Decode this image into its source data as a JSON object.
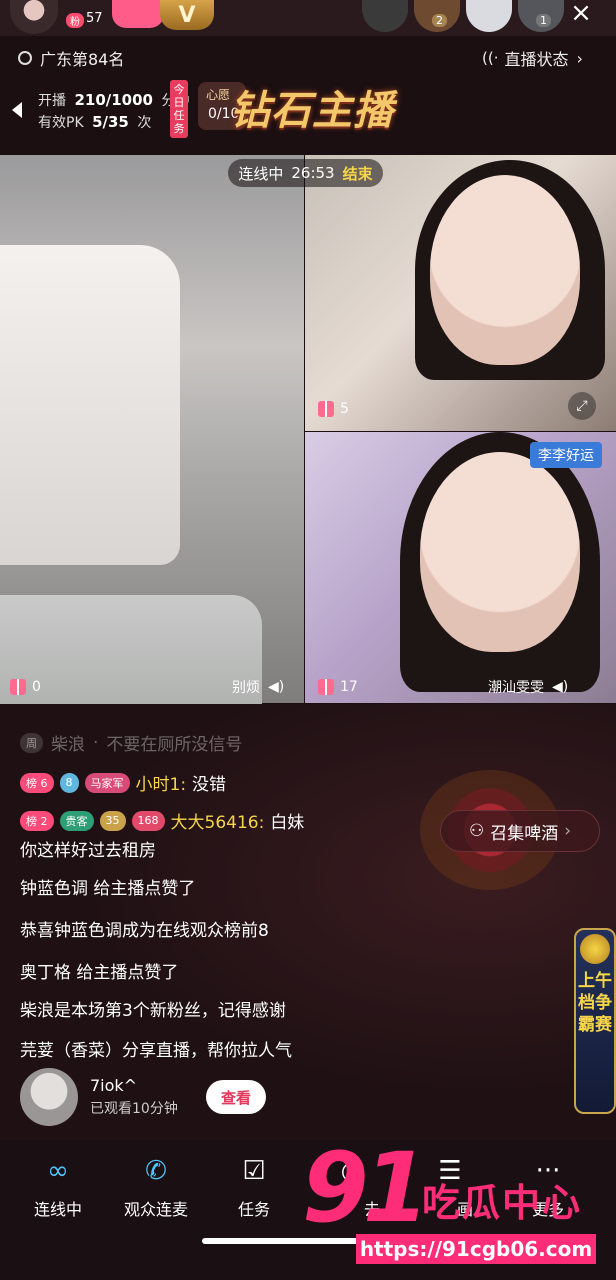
{
  "header": {
    "fans_badge": "粉",
    "fans_count": "57",
    "v_badge": "V",
    "viewer_counts": [
      "2",
      "",
      "1"
    ],
    "close_icon": "×"
  },
  "rank": {
    "text": "广东第84名"
  },
  "live_status": {
    "label": "直播状态",
    "chevron": "›"
  },
  "tasks": {
    "line1_prefix": "开播",
    "line1_value": "210/1000",
    "line1_unit": "分钟",
    "line2_prefix": "有效PK",
    "line2_value": "5/35",
    "line2_unit": "次",
    "today_badge": "今日任务",
    "heart_label": "心愿",
    "heart_value": "0/10",
    "title": "钻石主播"
  },
  "connect": {
    "status": "连线中",
    "timer": "26:53",
    "end_label": "结束"
  },
  "videos": {
    "left_gifts": "0",
    "left_name": "别烦",
    "right_top_gifts": "5",
    "right_bottom_gifts": "17",
    "right_bottom_name": "潮汕雯雯",
    "right_bottom_tag": "李李好运"
  },
  "chat": {
    "faded": {
      "badge": "周",
      "name": "柴浪",
      "text": "不要在厕所没信号"
    },
    "line1": {
      "b1": "榜 6",
      "b2": "8",
      "b3": "马家军",
      "name": "小时1:",
      "text": "没错"
    },
    "line2": {
      "b1": "榜 2",
      "b2": "贵客",
      "b3": "35",
      "b4": "168",
      "name": "大大56416:",
      "text": "白妹",
      "text2": "你这样好过去租房"
    },
    "line3": "钟蓝色调 给主播点赞了",
    "line4": "恭喜钟蓝色调成为在线观众榜前8",
    "line5": "奥丁格 给主播点赞了",
    "line6": "柴浪是本场第3个新粉丝，记得感谢",
    "line7": "芫荽（香菜）分享直播，帮你拉人气"
  },
  "beer_button": {
    "label": "召集啤酒",
    "chevron": "›"
  },
  "viewer": {
    "name": "7iok^",
    "watched": "已观看10分钟",
    "button": "查看"
  },
  "contest": {
    "text": "上午档争霸赛"
  },
  "bottom_nav": [
    {
      "label": "连线中",
      "icon": "link-icon"
    },
    {
      "label": "观众连麦",
      "icon": "phone-icon"
    },
    {
      "label": "任务",
      "icon": "task-icon"
    },
    {
      "label": "去",
      "icon": "clock-icon"
    },
    {
      "label": "画",
      "icon": "sliders-icon"
    },
    {
      "label": "更多",
      "icon": "more-icon"
    }
  ],
  "watermark": {
    "big": "91",
    "cn": "吃瓜中心",
    "url": "https://91cgb06.com"
  },
  "colors": {
    "accent": "#ff2d77",
    "gold": "#f6d548",
    "badge_blue": "#3a7ad8"
  }
}
